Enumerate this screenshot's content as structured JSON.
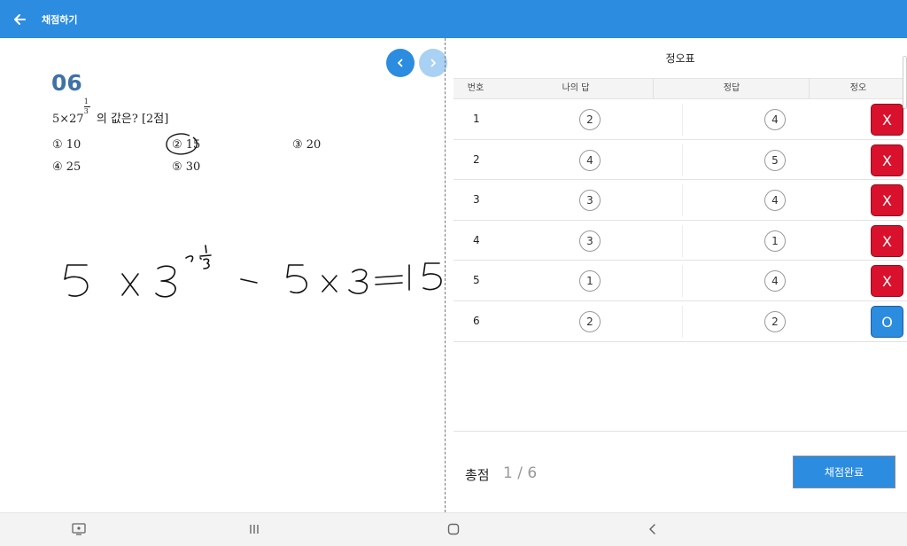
{
  "appbar": {
    "title": "채점하기",
    "color": "#2b8ce0"
  },
  "question": {
    "number": "06",
    "text_prefix": "5×27",
    "exponent_num": "1",
    "exponent_den": "3",
    "text_suffix": " 의 값은? [2점]",
    "choices": [
      "① 10",
      "② 15",
      "③ 20",
      "④ 25",
      "⑤ 30"
    ]
  },
  "panel": {
    "title": "정오표",
    "headers": {
      "no": "번호",
      "mine": "나의 답",
      "key": "정답",
      "verdict": "정오"
    }
  },
  "rows": [
    {
      "no": "1",
      "mine": "2",
      "key": "4",
      "verdict": "X",
      "correct": false
    },
    {
      "no": "2",
      "mine": "4",
      "key": "5",
      "verdict": "X",
      "correct": false
    },
    {
      "no": "3",
      "mine": "3",
      "key": "4",
      "verdict": "X",
      "correct": false
    },
    {
      "no": "4",
      "mine": "3",
      "key": "1",
      "verdict": "X",
      "correct": false
    },
    {
      "no": "5",
      "mine": "1",
      "key": "4",
      "verdict": "X",
      "correct": false
    },
    {
      "no": "6",
      "mine": "2",
      "key": "2",
      "verdict": "O",
      "correct": true
    }
  ],
  "score": {
    "label": "총점",
    "value": "1 / 6"
  },
  "done_button": "채점완료",
  "colors": {
    "wrong": "#d9112d",
    "right": "#2b8ce0"
  }
}
